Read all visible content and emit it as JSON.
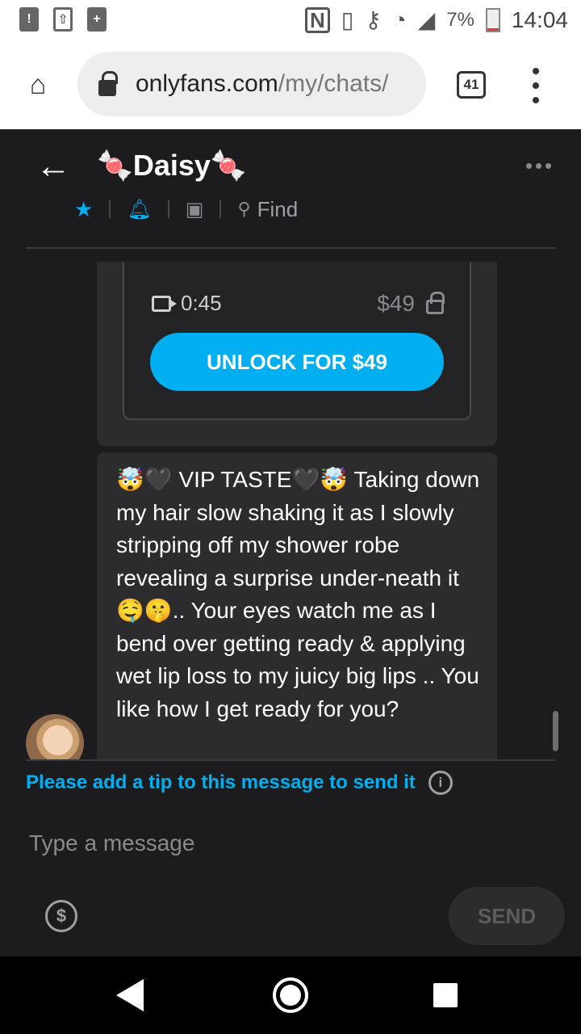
{
  "status_bar": {
    "battery_percent": "7%",
    "time": "14:04",
    "notification_icons": [
      "alert-icon",
      "upload-icon",
      "battery-saver-icon"
    ],
    "system_icons": [
      "nfc-icon",
      "vibrate-icon",
      "key-icon",
      "wifi-icon",
      "signal-icon",
      "battery-icon"
    ]
  },
  "browser": {
    "url_domain": "onlyfans.com",
    "url_path": "/my/chats/",
    "tab_count": "41"
  },
  "chat": {
    "name": "🍬Daisy🍬",
    "find_label": "Find",
    "toolbar_icons": [
      "star-icon",
      "bell-icon",
      "image-icon",
      "search-icon"
    ]
  },
  "locked_media": {
    "duration": "0:45",
    "price": "$49",
    "unlock_label": "UNLOCK FOR $49"
  },
  "message": {
    "text": "🤯🖤 VIP TASTE🖤🤯 Taking down my hair slow shaking it as I slowly stripping off my shower robe revealing a surprise under-neath it 🤤🤫.. Your eyes watch me as I bend over getting ready & applying wet lip loss to my juicy big lips .. You like how I get ready for you?"
  },
  "composer": {
    "tip_notice": "Please add a tip to this message to send it",
    "placeholder": "Type a message",
    "send_label": "SEND"
  },
  "colors": {
    "accent": "#00aff0",
    "background": "#1c1c1e",
    "bubble": "#2c2c2e"
  }
}
